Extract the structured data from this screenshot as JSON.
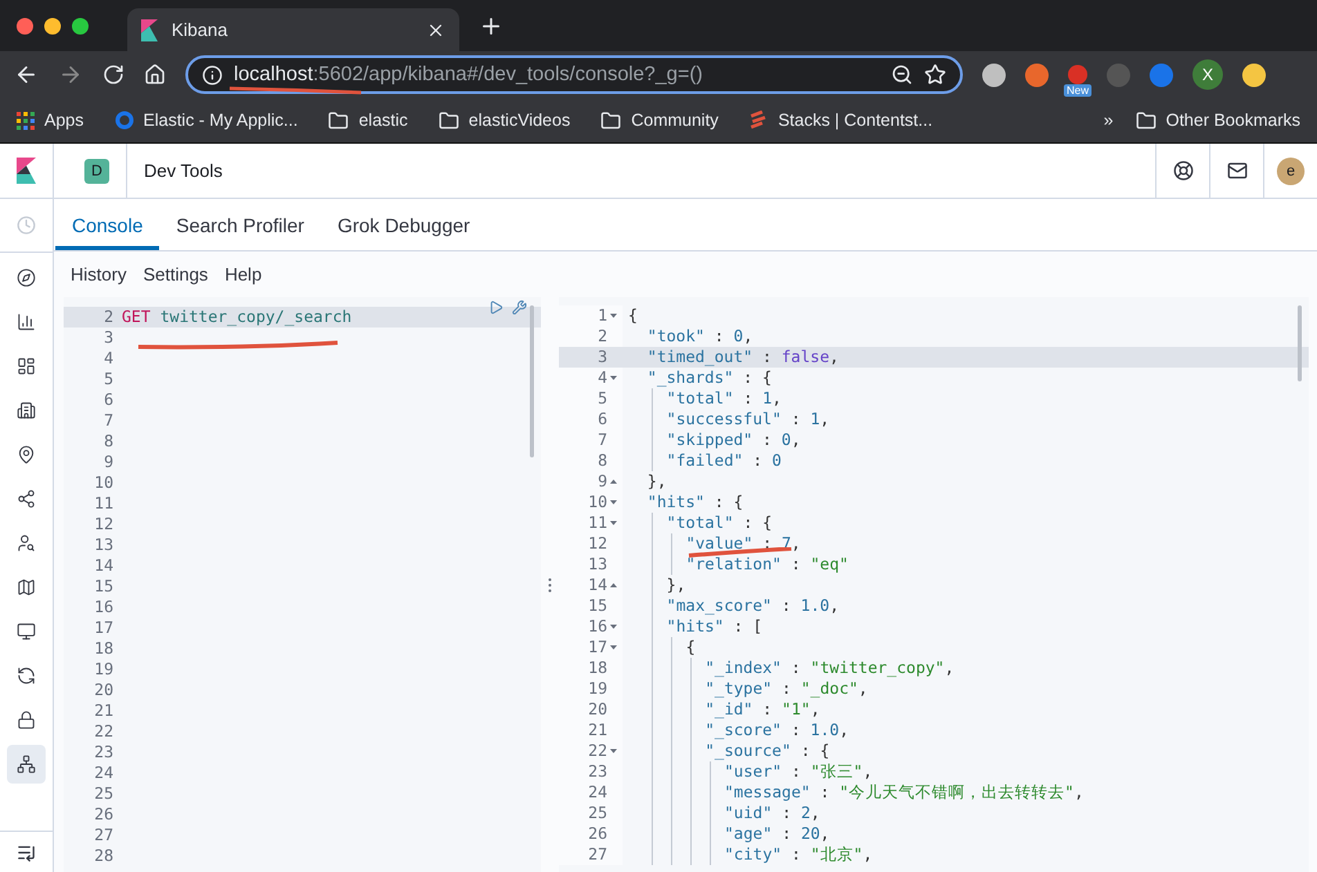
{
  "browser": {
    "tab_title": "Kibana",
    "url_host": "localhost",
    "url_rest": ":5602/app/kibana#/dev_tools/console?_g=()",
    "extension_badge": "New",
    "profile": "X",
    "bookmarks": [
      {
        "label": "Apps",
        "kind": "apps"
      },
      {
        "label": "Elastic - My Applic...",
        "kind": "site"
      },
      {
        "label": "elastic",
        "kind": "folder"
      },
      {
        "label": "elasticVideos",
        "kind": "folder"
      },
      {
        "label": "Community",
        "kind": "folder"
      },
      {
        "label": "Stacks | Contentst...",
        "kind": "stacks"
      }
    ],
    "overflow": "»",
    "other_bookmarks": "Other Bookmarks"
  },
  "header": {
    "space": "D",
    "title": "Dev Tools",
    "user": "e"
  },
  "nav_items": [
    {
      "selected": false
    },
    {
      "selected": false
    },
    {
      "selected": false
    },
    {
      "selected": false
    },
    {
      "selected": false
    },
    {
      "selected": false
    },
    {
      "selected": false
    },
    {
      "selected": false
    },
    {
      "selected": false
    },
    {
      "selected": false
    },
    {
      "selected": false
    },
    {
      "selected": true
    }
  ],
  "tabs": [
    {
      "label": "Console",
      "selected": true
    },
    {
      "label": "Search Profiler",
      "selected": false
    },
    {
      "label": "Grok Debugger",
      "selected": false
    }
  ],
  "menu": [
    "History",
    "Settings",
    "Help"
  ],
  "input": {
    "lines": [
      {
        "n": "2",
        "code": "GET twitter_copy/_search",
        "active": true
      },
      {
        "n": "3",
        "active": false
      },
      {
        "n": "4",
        "active": false
      },
      {
        "n": "5",
        "active": false
      },
      {
        "n": "6",
        "active": false
      },
      {
        "n": "7",
        "active": false
      },
      {
        "n": "8",
        "active": false
      },
      {
        "n": "9",
        "active": false
      },
      {
        "n": "10",
        "active": false
      },
      {
        "n": "11",
        "active": false
      },
      {
        "n": "12",
        "active": false
      },
      {
        "n": "13",
        "active": false
      },
      {
        "n": "14",
        "active": false
      },
      {
        "n": "15",
        "active": false
      },
      {
        "n": "16",
        "active": false
      },
      {
        "n": "17",
        "active": false
      },
      {
        "n": "18",
        "active": false
      },
      {
        "n": "19",
        "active": false
      },
      {
        "n": "20",
        "active": false
      },
      {
        "n": "21",
        "active": false
      },
      {
        "n": "22",
        "active": false
      },
      {
        "n": "23",
        "active": false
      },
      {
        "n": "24",
        "active": false
      },
      {
        "n": "25",
        "active": false
      },
      {
        "n": "26",
        "active": false
      },
      {
        "n": "27",
        "active": false
      },
      {
        "n": "28",
        "active": false
      }
    ]
  },
  "output": {
    "lines": [
      {
        "n": "1",
        "kind": "open",
        "code": "{",
        "active": false
      },
      {
        "n": "2",
        "kind": "plain",
        "code": "  \"took\" : 0,",
        "active": false
      },
      {
        "n": "3",
        "kind": "plain",
        "code": "  \"timed_out\" : false,",
        "active": true
      },
      {
        "n": "4",
        "kind": "open",
        "code": "  \"_shards\" : {",
        "active": false
      },
      {
        "n": "5",
        "kind": "plain",
        "code": "    \"total\" : 1,",
        "active": false
      },
      {
        "n": "6",
        "kind": "plain",
        "code": "    \"successful\" : 1,",
        "active": false
      },
      {
        "n": "7",
        "kind": "plain",
        "code": "    \"skipped\" : 0,",
        "active": false
      },
      {
        "n": "8",
        "kind": "plain",
        "code": "    \"failed\" : 0",
        "active": false
      },
      {
        "n": "9",
        "kind": "close",
        "code": "  },",
        "active": false
      },
      {
        "n": "10",
        "kind": "open",
        "code": "  \"hits\" : {",
        "active": false
      },
      {
        "n": "11",
        "kind": "open",
        "code": "    \"total\" : {",
        "active": false
      },
      {
        "n": "12",
        "kind": "plain",
        "code": "      \"value\" : 7,",
        "active": false
      },
      {
        "n": "13",
        "kind": "plain",
        "code": "      \"relation\" : \"eq\"",
        "active": false
      },
      {
        "n": "14",
        "kind": "close",
        "code": "    },",
        "active": false
      },
      {
        "n": "15",
        "kind": "plain",
        "code": "    \"max_score\" : 1.0,",
        "active": false
      },
      {
        "n": "16",
        "kind": "open",
        "code": "    \"hits\" : [",
        "active": false
      },
      {
        "n": "17",
        "kind": "open",
        "code": "      {",
        "active": false
      },
      {
        "n": "18",
        "kind": "plain",
        "code": "        \"_index\" : \"twitter_copy\",",
        "active": false
      },
      {
        "n": "19",
        "kind": "plain",
        "code": "        \"_type\" : \"_doc\",",
        "active": false
      },
      {
        "n": "20",
        "kind": "plain",
        "code": "        \"_id\" : \"1\",",
        "active": false
      },
      {
        "n": "21",
        "kind": "plain",
        "code": "        \"_score\" : 1.0,",
        "active": false
      },
      {
        "n": "22",
        "kind": "open",
        "code": "        \"_source\" : {",
        "active": false
      },
      {
        "n": "23",
        "kind": "plain",
        "code": "          \"user\" : \"张三\",",
        "active": false
      },
      {
        "n": "24",
        "kind": "plain",
        "code": "          \"message\" : \"今儿天气不错啊，出去转转去\",",
        "active": false
      },
      {
        "n": "25",
        "kind": "plain",
        "code": "          \"uid\" : 2,",
        "active": false
      },
      {
        "n": "26",
        "kind": "plain",
        "code": "          \"age\" : 20,",
        "active": false
      },
      {
        "n": "27",
        "kind": "plain",
        "code": "          \"city\" : \"北京\",",
        "active": false
      }
    ]
  }
}
